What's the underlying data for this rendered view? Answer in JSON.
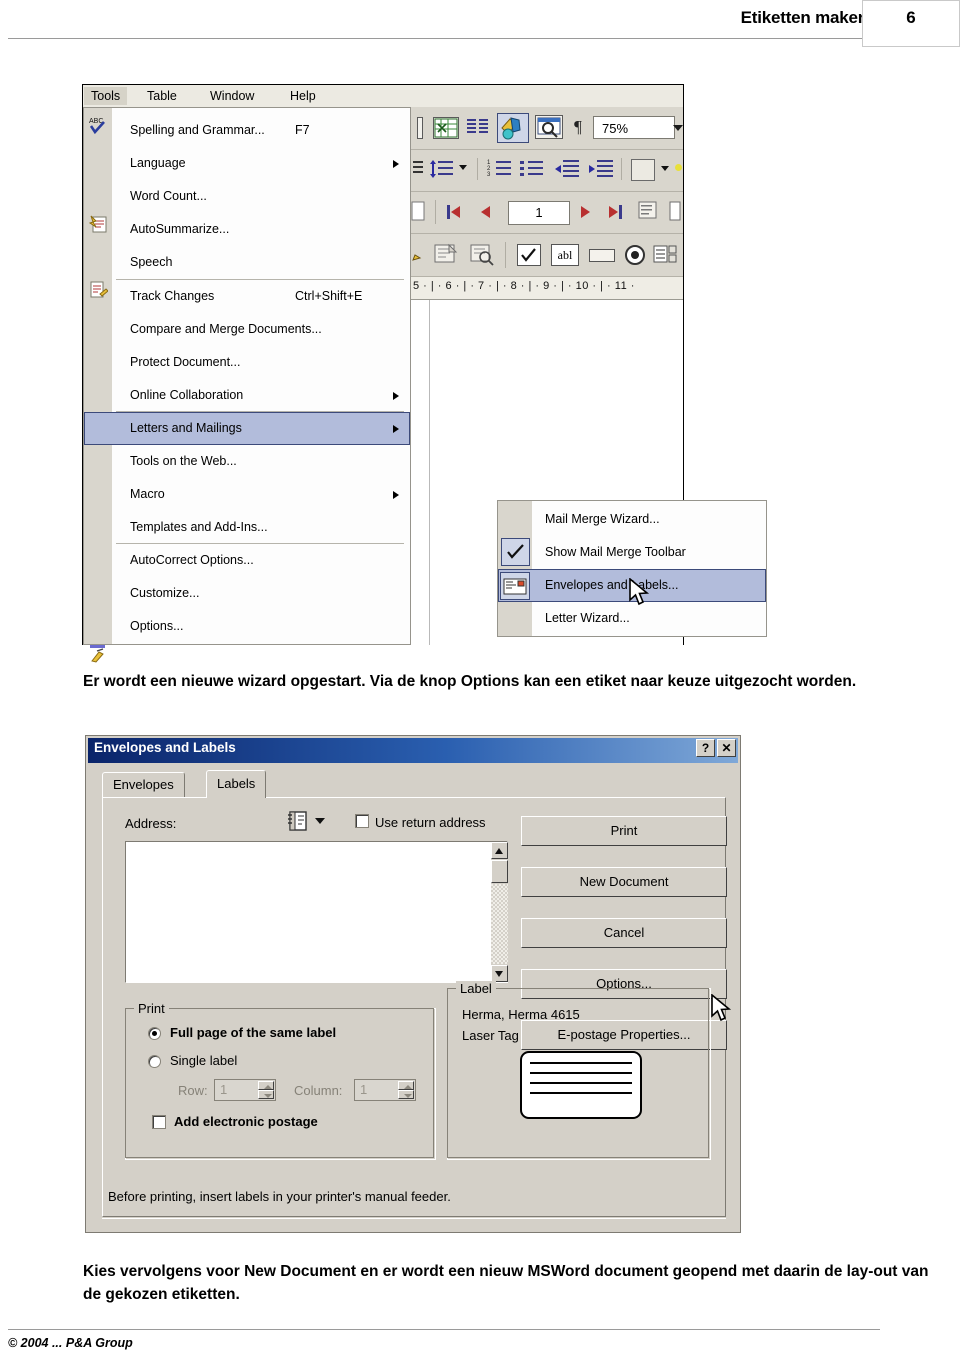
{
  "header": {
    "title": "Etiketten maken",
    "page_number": "6"
  },
  "footer": {
    "copyright": "© 2004 ... P&A Group"
  },
  "paragraphs": {
    "top": "Er wordt een nieuwe wizard opgestart. Via de knop Options kan een etiket naar keuze uitgezocht worden.",
    "bottom": "Kies vervolgens voor New Document en er wordt een nieuw MSWord document geopend met daarin de lay-out van de gekozen etiketten."
  },
  "menu_screenshot": {
    "menubar": [
      {
        "label": "Tools",
        "active": true
      },
      {
        "label": "Table",
        "active": false
      },
      {
        "label": "Window",
        "active": false
      },
      {
        "label": "Help",
        "active": false
      }
    ],
    "tools_menu": [
      {
        "label": "Spelling and Grammar...",
        "accel": "F7",
        "icon": "spellcheck-icon",
        "arrow": false,
        "selected": false
      },
      {
        "label": "Language",
        "accel": "",
        "icon": "",
        "arrow": true,
        "selected": false
      },
      {
        "label": "Word Count...",
        "accel": "",
        "icon": "",
        "arrow": false,
        "selected": false
      },
      {
        "label": "AutoSummarize...",
        "accel": "",
        "icon": "autosummarize-icon",
        "arrow": false,
        "selected": false
      },
      {
        "label": "Speech",
        "accel": "",
        "icon": "",
        "arrow": false,
        "selected": false
      },
      {
        "label": "Track Changes",
        "accel": "Ctrl+Shift+E",
        "icon": "trackchanges-icon",
        "arrow": false,
        "selected": false
      },
      {
        "label": "Compare and Merge Documents...",
        "accel": "",
        "icon": "",
        "arrow": false,
        "selected": false
      },
      {
        "label": "Protect Document...",
        "accel": "",
        "icon": "",
        "arrow": false,
        "selected": false
      },
      {
        "label": "Online Collaboration",
        "accel": "",
        "icon": "",
        "arrow": true,
        "selected": false
      },
      {
        "label": "Letters and Mailings",
        "accel": "",
        "icon": "",
        "arrow": true,
        "selected": true
      },
      {
        "label": "Tools on the Web...",
        "accel": "",
        "icon": "",
        "arrow": false,
        "selected": false
      },
      {
        "label": "Macro",
        "accel": "",
        "icon": "",
        "arrow": true,
        "selected": false
      },
      {
        "label": "Templates and Add-Ins...",
        "accel": "",
        "icon": "",
        "arrow": false,
        "selected": false
      },
      {
        "label": "AutoCorrect Options...",
        "accel": "",
        "icon": "autocorrect-icon",
        "arrow": false,
        "selected": false
      },
      {
        "label": "Customize...",
        "accel": "",
        "icon": "",
        "arrow": false,
        "selected": false
      },
      {
        "label": "Options...",
        "accel": "",
        "icon": "",
        "arrow": false,
        "selected": false
      }
    ],
    "submenu": [
      {
        "label": "Mail Merge Wizard...",
        "checked": false,
        "icon": "",
        "selected": false
      },
      {
        "label": "Show Mail Merge Toolbar",
        "checked": true,
        "icon": "check-icon",
        "selected": false
      },
      {
        "label": "Envelopes and Labels...",
        "checked": false,
        "icon": "envelope-label-icon",
        "selected": true
      },
      {
        "label": "Letter Wizard...",
        "checked": false,
        "icon": "",
        "selected": false
      }
    ],
    "toolbar": {
      "zoom_value": "75%",
      "page_value": "1",
      "ruler_text": "5 · | · 6 · | · 7 · | · 8 · | · 9 · | · 10 · | · 11 ·"
    }
  },
  "dialog": {
    "title": "Envelopes and Labels",
    "titlebar_buttons": [
      {
        "name": "help-button",
        "glyph": "?"
      },
      {
        "name": "close-button",
        "glyph": "✕"
      }
    ],
    "tabs": [
      {
        "label": "Envelopes",
        "active": false
      },
      {
        "label": "Labels",
        "active": true
      }
    ],
    "address_label": "Address:",
    "address_value": "",
    "use_return_address": {
      "label": "Use return address",
      "checked": false
    },
    "buttons": [
      {
        "label": "Print"
      },
      {
        "label": "New Document"
      },
      {
        "label": "Cancel"
      },
      {
        "label": "Options..."
      },
      {
        "label": "E-postage Properties..."
      }
    ],
    "print_group": {
      "title": "Print",
      "options": [
        {
          "label": "Full page of the same label",
          "selected": true
        },
        {
          "label": "Single label",
          "selected": false
        }
      ],
      "row_label": "Row:",
      "row_value": "1",
      "column_label": "Column:",
      "column_value": "1",
      "postage_checkbox": {
        "label": "Add electronic postage",
        "checked": false
      }
    },
    "label_group": {
      "title": "Label",
      "line1": "Herma, Herma 4615",
      "line2": "Laser Tag"
    },
    "status_text": "Before printing, insert labels in your printer's manual feeder."
  },
  "colors": {
    "titlebar_start": "#0a246a",
    "titlebar_end": "#7fa8d8",
    "dialog_face": "#d4d0c8",
    "menu_highlight": "#b2bcdb",
    "menu_highlight_border": "#3c4a7a"
  }
}
